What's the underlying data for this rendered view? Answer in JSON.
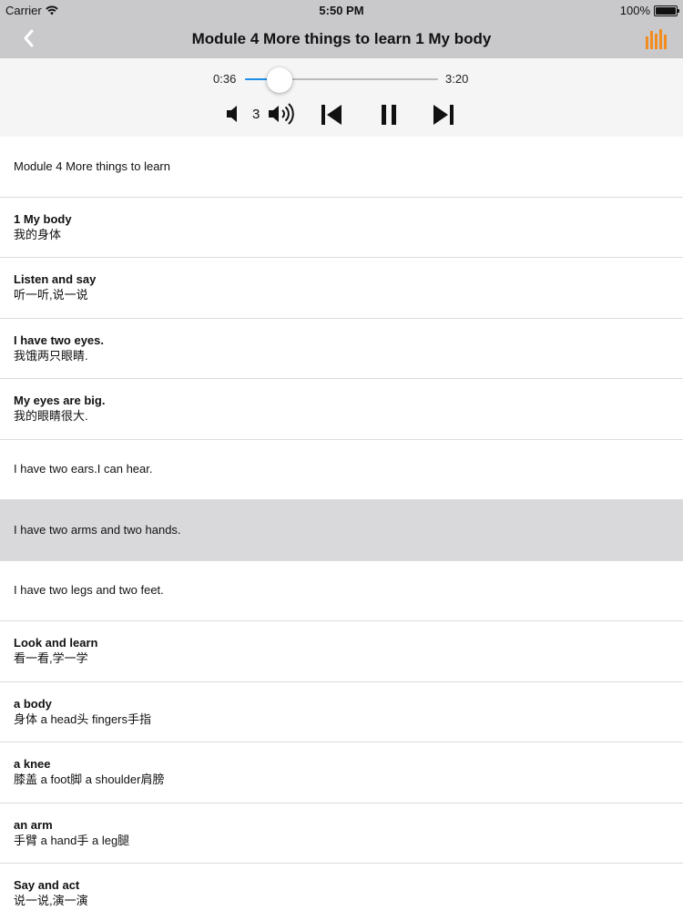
{
  "status": {
    "carrier": "Carrier",
    "time": "5:50 PM",
    "battery": "100%",
    "battery_level": 1.0
  },
  "nav": {
    "title": "Module 4 More things to learn 1 My body",
    "back_icon": "chevron-left-icon",
    "menu_icon": "equalizer-icon",
    "accent_color": "#f28c1e"
  },
  "player": {
    "current_time": "0:36",
    "total_time": "3:20",
    "progress": 0.18,
    "volume": "3",
    "progress_color": "#1e8ce8"
  },
  "items": [
    {
      "en": "Module 4 More things to learn",
      "zh": ""
    },
    {
      "en": "1 My body",
      "zh": "我的身体"
    },
    {
      "en": "Listen and say",
      "zh": "听一听,说一说"
    },
    {
      "en": "I have two eyes.",
      "zh": "我饿两只眼睛."
    },
    {
      "en": "My eyes are big.",
      "zh": "我的眼睛很大."
    },
    {
      "en": "I have two ears.I can hear.",
      "zh": ""
    },
    {
      "en": "I have two arms and two hands.",
      "zh": "",
      "highlight": true
    },
    {
      "en": "I have two legs and two feet.",
      "zh": ""
    },
    {
      "en": "Look and learn",
      "zh": "看一看,学一学"
    },
    {
      "en": "a body",
      "zh": "身体 a head头 fingers手指"
    },
    {
      "en": "a knee",
      "zh": "膝盖 a foot脚 a shoulder肩膀"
    },
    {
      "en": "an arm",
      "zh": "手臂 a hand手 a leg腿"
    },
    {
      "en": "Say and act",
      "zh": "说一说,演一演"
    }
  ]
}
